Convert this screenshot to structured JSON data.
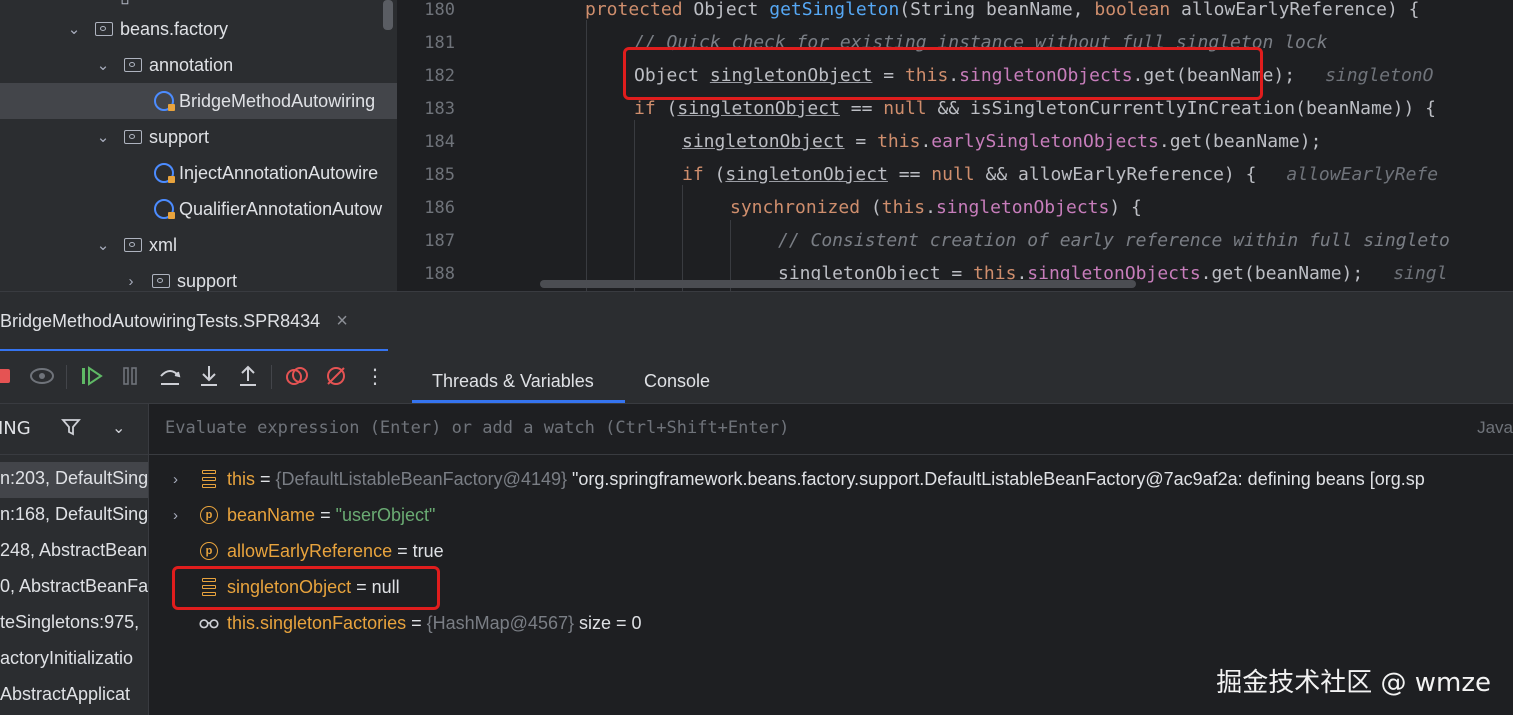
{
  "tree": {
    "items": [
      {
        "label": "beans.factory",
        "type": "folder",
        "expanded": true
      },
      {
        "label": "annotation",
        "type": "folder",
        "expanded": true
      },
      {
        "label": "BridgeMethodAutowiring",
        "type": "class",
        "selected": true
      },
      {
        "label": "support",
        "type": "folder",
        "expanded": true
      },
      {
        "label": "InjectAnnotationAutowire",
        "type": "class"
      },
      {
        "label": "QualifierAnnotationAutow",
        "type": "class"
      },
      {
        "label": "xml",
        "type": "folder",
        "expanded": true
      },
      {
        "label": "support",
        "type": "folder",
        "expanded": false
      }
    ]
  },
  "editor": {
    "line_numbers": [
      "180",
      "181",
      "182",
      "183",
      "184",
      "185",
      "186",
      "187",
      "188"
    ],
    "lines": {
      "l180": {
        "kw1": "protected ",
        "t1": "Object ",
        "fn": "getSingleton",
        "t2": "(String beanName, ",
        "kw2": "boolean",
        "t3": " allowEarlyReference) {"
      },
      "l181": {
        "comment": "// Quick check for existing instance without full singleton lock"
      },
      "l182": {
        "t1": "Object ",
        "var": "singletonObject",
        "t2": " = ",
        "kw": "this",
        "t3": ".",
        "fld": "singletonObjects",
        "t4": ".get(beanName);",
        "hint": "singletonO"
      },
      "l183": {
        "kw1": "if",
        "t1": " (",
        "var": "singletonObject",
        "t2": " == ",
        "kw2": "null",
        "t3": " && isSingletonCurrentlyInCreation(beanName)) {"
      },
      "l184": {
        "var": "singletonObject",
        "t1": " = ",
        "kw": "this",
        "t2": ".",
        "fld": "earlySingletonObjects",
        "t3": ".get(beanName);"
      },
      "l185": {
        "kw1": "if",
        "t1": " (",
        "var": "singletonObject",
        "t2": " == ",
        "kw2": "null",
        "t3": " && allowEarlyReference) {",
        "hint": "allowEarlyRefe"
      },
      "l186": {
        "kw1": "synchronized",
        "t1": " (",
        "kw2": "this",
        "t2": ".",
        "fld": "singletonObjects",
        "t3": ") {"
      },
      "l187": {
        "comment": "// Consistent creation of early reference within full singleto"
      },
      "l188": {
        "var": "singletonObject",
        "t1": " = ",
        "kw": "this",
        "t2": ".",
        "fld": "singletonObjects",
        "t3": ".get(beanName);",
        "hint": "singl"
      }
    }
  },
  "debug": {
    "session_tab": "BridgeMethodAutowiringTests.SPR8434",
    "close_glyph": "×",
    "tabs": [
      "Threads & Variables",
      "Console"
    ],
    "thread_filter_label": "ING",
    "watch_placeholder": "Evaluate expression (Enter) or add a watch (Ctrl+Shift+Enter)",
    "watch_lang": "Java",
    "frames": [
      "n:203, DefaultSing",
      "n:168, DefaultSing",
      "248, AbstractBean",
      "0, AbstractBeanFa",
      "teSingletons:975,",
      "actoryInitializatio",
      "AbstractApplicat"
    ],
    "variables": [
      {
        "name": "this",
        "eq": " = ",
        "ref": "{DefaultListableBeanFactory@4149}",
        "value": " \"org.springframework.beans.factory.support.DefaultListableBeanFactory@7ac9af2a: defining beans [org.sp",
        "icon": "stack-icon",
        "expandable": true
      },
      {
        "name": "beanName",
        "eq": " = ",
        "ref": "",
        "value": "\"userObject\"",
        "icon": "parameter-icon",
        "expandable": true
      },
      {
        "name": "allowEarlyReference",
        "eq": " = ",
        "ref": "",
        "value": "true",
        "icon": "parameter-icon",
        "expandable": false
      },
      {
        "name": "singletonObject",
        "eq": " = ",
        "ref": "",
        "value": "null",
        "icon": "stack-icon",
        "expandable": false
      },
      {
        "name": "this.singletonFactories",
        "eq": " = ",
        "ref": "{HashMap@4567}",
        "value": "  size = 0",
        "icon": "watch-glasses-icon",
        "expandable": false
      }
    ]
  },
  "watermark": "掘金技术社区 @ wmze",
  "colors": {
    "highlight_box": "#e01d1d",
    "accent": "#3574f0",
    "keyword": "#cf8e6d",
    "field": "#c77dbb",
    "method": "#56a8f5"
  }
}
